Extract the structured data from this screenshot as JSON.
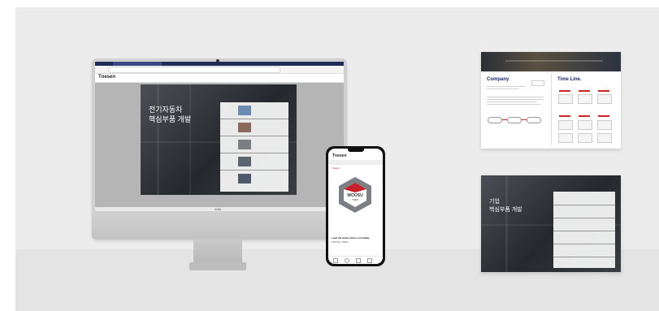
{
  "browser": {
    "site_logo": "Tnesen"
  },
  "desktop_slide": {
    "title_line1": "전기자동차",
    "title_line2": "핵심부품 개발",
    "page_indicator": "1/16"
  },
  "phone": {
    "site_logo": "Tnesen",
    "section_label": "Tnesen",
    "badge_brand": "WOOSU",
    "badge_sub": "TNES",
    "caption_bold": "Lead the better future of mobility",
    "caption_small": "WOOSU TNES"
  },
  "card1": {
    "company_title": "Company",
    "timeline_title": "Time Line."
  },
  "card2": {
    "title_line1": "기업",
    "title_line2": "핵심부품 개발"
  },
  "colors": {
    "brand_navy": "#1b2a6b",
    "brand_red": "#c8202a",
    "browser_chrome": "#1e2c57"
  }
}
